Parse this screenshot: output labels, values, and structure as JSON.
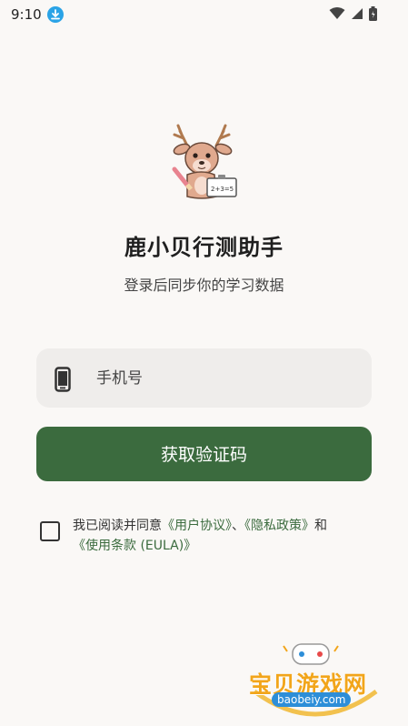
{
  "status_bar": {
    "time": "9:10"
  },
  "app": {
    "title": "鹿小贝行测助手",
    "subtitle": "登录后同步你的学习数据",
    "logo_board_text": "2+3=5"
  },
  "phone_field": {
    "placeholder": "手机号",
    "value": ""
  },
  "get_code_button": {
    "label": "获取验证码"
  },
  "agreement": {
    "checked": false,
    "prefix": "我已阅读并同意",
    "user_agreement": "《用户协议》",
    "sep": "、",
    "privacy_policy": "《隐私政策》",
    "and": "和",
    "eula": "《使用条款 (EULA)》"
  },
  "watermark": {
    "main": "宝贝游戏网",
    "sub": "baobeiy.com"
  },
  "colors": {
    "accent": "#3b6b3e",
    "background": "#faf8f6",
    "field_bg": "#efedeb"
  }
}
